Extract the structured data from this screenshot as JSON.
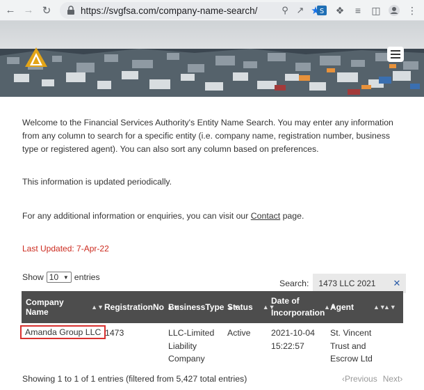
{
  "browser": {
    "url": "https://svgfsa.com/company-name-search/"
  },
  "site": {
    "menu_label": ""
  },
  "intro": {
    "para1": "Welcome to the Financial Services Authority's Entity Name Search. You may enter any information from any column to search for a specific entity (i.e. company name, registration number, business type or registered agent). You can also sort any column based on preferences.",
    "para2": "This information is updated periodically.",
    "para3_before": "For any additional information or enquiries, you can visit our ",
    "para3_link": "Contact",
    "para3_after": " page.",
    "last_updated": "Last Updated:  7-Apr-22"
  },
  "table_controls": {
    "show_label": "Show",
    "entries_value": "10",
    "entries_label": "entries",
    "search_label": "Search:",
    "search_value": "1473 LLC 2021"
  },
  "table": {
    "headers": [
      "Company Name",
      "RegistrationNo",
      "BusinessType",
      "Status",
      "Date of Incorporation",
      "Agent",
      ""
    ],
    "rows": [
      {
        "company": "Amanda Group LLC",
        "registration": "1473",
        "business_type": "LLC-Limited Liability Company",
        "status": "Active",
        "date": "2021-10-04 15:22:57",
        "agent": "St. Vincent Trust and Escrow Ltd"
      }
    ]
  },
  "footer": {
    "info": "Showing 1 to 1 of 1 entries (filtered from 5,427 total entries)",
    "previous": "Previous",
    "next": "Next"
  },
  "colors": {
    "header_bg": "#4d4d4d",
    "last_updated": "#cc2a1e",
    "highlight_border": "#d8312f"
  }
}
